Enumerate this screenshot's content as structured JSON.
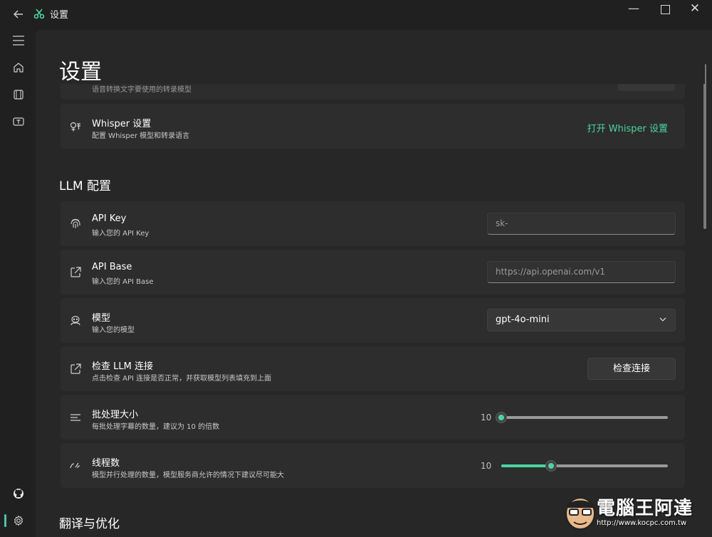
{
  "window": {
    "title": "设置",
    "back_icon": "back-arrow-icon",
    "logo_icon": "app-logo-icon",
    "minimize_icon": "minimize-icon",
    "maximize_icon": "maximize-icon",
    "close_icon": "close-icon"
  },
  "rail": {
    "items": [
      {
        "icon": "menu-icon"
      },
      {
        "icon": "home-icon"
      },
      {
        "icon": "video-icon"
      },
      {
        "icon": "subtitle-icon"
      }
    ],
    "bottom": [
      {
        "icon": "github-icon"
      },
      {
        "icon": "settings-icon"
      }
    ]
  },
  "page": {
    "title": "设置",
    "partial_card_desc": "语音转换文字要使用的转录模型",
    "whisper": {
      "title": "Whisper 设置",
      "desc": "配置 Whisper 模型和转录语言",
      "action": "打开 Whisper 设置"
    },
    "llm_section": "LLM 配置",
    "api_key": {
      "title": "API Key",
      "desc": "输入您的 API Key",
      "value": "sk-"
    },
    "api_base": {
      "title": "API Base",
      "desc": "输入您的 API Base",
      "value": "https://api.openai.com/v1"
    },
    "model": {
      "title": "模型",
      "desc": "输入您的模型",
      "value": "gpt-4o-mini"
    },
    "check": {
      "title": "检查 LLM 连接",
      "desc": "点击检查 API 连接是否正常，并获取模型列表填充到上面",
      "button": "检查连接"
    },
    "batch": {
      "title": "批处理大小",
      "desc": "每批处理字幕的数量，建议为 10 的倍数",
      "value": "10",
      "fraction": 0.0
    },
    "threads": {
      "title": "线程数",
      "desc": "模型并行处理的数量，模型服务商允许的情况下建议尽可能大",
      "value": "10",
      "fraction": 0.3
    },
    "translate_section": "翻译与优化"
  },
  "watermark": {
    "text": "電腦王阿達",
    "url": "http://www.kocpc.com.tw"
  },
  "colors": {
    "accent": "#4cd4a0",
    "background": "#202020",
    "content": "#272727",
    "card": "#2d2d2d"
  }
}
